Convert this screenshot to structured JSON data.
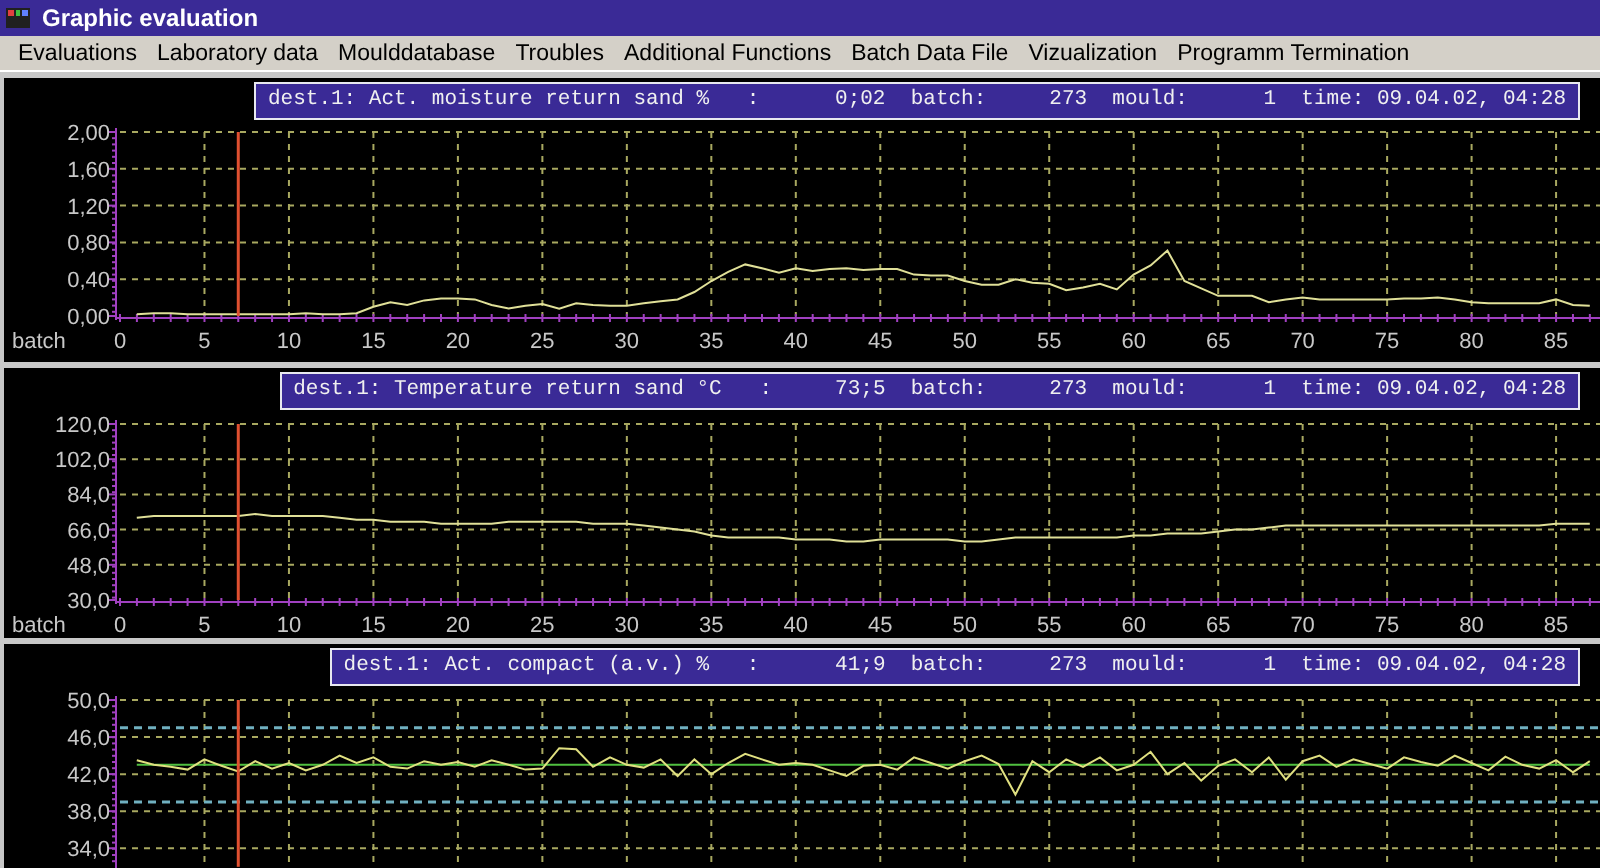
{
  "window": {
    "title": "Graphic evaluation"
  },
  "menu": [
    "Evaluations",
    "Laboratory data",
    "Moulddatabase",
    "Troubles",
    "Additional Functions",
    "Batch Data File",
    "Vizualization",
    "Programm Termination"
  ],
  "panels": [
    {
      "header": "dest.1: Act. moisture return sand %   :      0;02  batch:     273  mould:      1  time: 09.04.02, 04:28",
      "chart_data": {
        "type": "line",
        "xlabel": "batch",
        "xlim": [
          0,
          87.6
        ],
        "ylim": [
          0,
          2
        ],
        "grid": true,
        "x": [
          1,
          2,
          3,
          4,
          5,
          6,
          7,
          8,
          9,
          10,
          11,
          12,
          13,
          14,
          15,
          16,
          17,
          18,
          19,
          20,
          21,
          22,
          23,
          24,
          25,
          26,
          27,
          28,
          29,
          30,
          31,
          32,
          33,
          34,
          35,
          36,
          37,
          38,
          39,
          40,
          41,
          42,
          43,
          44,
          45,
          46,
          47,
          48,
          49,
          50,
          51,
          52,
          53,
          54,
          55,
          56,
          57,
          58,
          59,
          60,
          61,
          62,
          63,
          64,
          65,
          66,
          67,
          68,
          69,
          70,
          71,
          72,
          73,
          74,
          75,
          76,
          77,
          78,
          79,
          80,
          81,
          82,
          83,
          84,
          85,
          86,
          87
        ],
        "series": [
          {
            "color": "#e0e098",
            "values": [
              0.02,
              0.03,
              0.03,
              0.02,
              0.02,
              0.02,
              0.02,
              0.02,
              0.02,
              0.02,
              0.03,
              0.02,
              0.02,
              0.03,
              0.1,
              0.15,
              0.12,
              0.17,
              0.19,
              0.19,
              0.18,
              0.12,
              0.08,
              0.11,
              0.13,
              0.08,
              0.14,
              0.12,
              0.11,
              0.11,
              0.14,
              0.16,
              0.18,
              0.26,
              0.38,
              0.48,
              0.56,
              0.52,
              0.47,
              0.52,
              0.49,
              0.51,
              0.52,
              0.5,
              0.51,
              0.51,
              0.45,
              0.44,
              0.44,
              0.38,
              0.34,
              0.34,
              0.4,
              0.36,
              0.35,
              0.28,
              0.31,
              0.35,
              0.29,
              0.45,
              0.55,
              0.71,
              0.38,
              0.3,
              0.22,
              0.22,
              0.22,
              0.15,
              0.18,
              0.2,
              0.18,
              0.18,
              0.18,
              0.18,
              0.18,
              0.19,
              0.19,
              0.2,
              0.18,
              0.15,
              0.14,
              0.14,
              0.14,
              0.14,
              0.18,
              0.12,
              0.11
            ]
          }
        ],
        "xticks": [
          0,
          5,
          10,
          15,
          20,
          25,
          30,
          35,
          40,
          45,
          50,
          55,
          60,
          65,
          70,
          75,
          80,
          85
        ],
        "yticks": [
          {
            "value": 0,
            "label": "0,00"
          },
          {
            "value": 0.4,
            "label": "0,40"
          },
          {
            "value": 0.8,
            "label": "0,80"
          },
          {
            "value": 1.2,
            "label": "1,20"
          },
          {
            "value": 1.6,
            "label": "1,60"
          },
          {
            "value": 2,
            "label": "2,00"
          }
        ],
        "ref_lines": [
          {
            "axis": "x",
            "value": 7,
            "color": "#e05030"
          }
        ]
      }
    },
    {
      "header": "dest.1: Temperature return sand °C   :     73;5  batch:     273  mould:      1  time: 09.04.02, 04:28",
      "chart_data": {
        "type": "line",
        "xlabel": "batch",
        "xlim": [
          0,
          87.6
        ],
        "ylim": [
          30,
          120
        ],
        "grid": true,
        "x": [
          1,
          2,
          3,
          4,
          5,
          6,
          7,
          8,
          9,
          10,
          11,
          12,
          13,
          14,
          15,
          16,
          17,
          18,
          19,
          20,
          21,
          22,
          23,
          24,
          25,
          26,
          27,
          28,
          29,
          30,
          31,
          32,
          33,
          34,
          35,
          36,
          37,
          38,
          39,
          40,
          41,
          42,
          43,
          44,
          45,
          46,
          47,
          48,
          49,
          50,
          51,
          52,
          53,
          54,
          55,
          56,
          57,
          58,
          59,
          60,
          61,
          62,
          63,
          64,
          65,
          66,
          67,
          68,
          69,
          70,
          71,
          72,
          73,
          74,
          75,
          76,
          77,
          78,
          79,
          80,
          81,
          82,
          83,
          84,
          85,
          86,
          87
        ],
        "series": [
          {
            "color": "#e0e098",
            "values": [
              72,
              73,
              73,
              73,
              73,
              73,
              73,
              74,
              73,
              73,
              73,
              73,
              72,
              71,
              71,
              70,
              70,
              70,
              69,
              69,
              69,
              69,
              70,
              70,
              70,
              70,
              70,
              69,
              69,
              69,
              68,
              67,
              66,
              65,
              63,
              62,
              62,
              62,
              62,
              61,
              61,
              61,
              60,
              60,
              61,
              61,
              61,
              61,
              61,
              60,
              60,
              61,
              62,
              62,
              62,
              62,
              62,
              62,
              62,
              63,
              63,
              64,
              64,
              64,
              65,
              66,
              66,
              67,
              68,
              68,
              68,
              68,
              68,
              68,
              68,
              68,
              68,
              68,
              68,
              68,
              68,
              68,
              68,
              68,
              69,
              69,
              69
            ]
          }
        ],
        "xticks": [
          0,
          5,
          10,
          15,
          20,
          25,
          30,
          35,
          40,
          45,
          50,
          55,
          60,
          65,
          70,
          75,
          80,
          85
        ],
        "yticks": [
          {
            "value": 30,
            "label": "30,0"
          },
          {
            "value": 48,
            "label": "48,0"
          },
          {
            "value": 66,
            "label": "66,0"
          },
          {
            "value": 84,
            "label": "84,0"
          },
          {
            "value": 102,
            "label": "102,0"
          },
          {
            "value": 120,
            "label": "120,0"
          }
        ],
        "ref_lines": [
          {
            "axis": "x",
            "value": 7,
            "color": "#e05030"
          }
        ]
      }
    },
    {
      "header": "dest.1: Act. compact (a.v.) %   :      41;9  batch:     273  mould:      1  time: 09.04.02, 04:28",
      "chart_data": {
        "type": "line",
        "xlim": [
          0,
          87.6
        ],
        "ylim": [
          32,
          50
        ],
        "grid": true,
        "x": [
          1,
          2,
          3,
          4,
          5,
          6,
          7,
          8,
          9,
          10,
          11,
          12,
          13,
          14,
          15,
          16,
          17,
          18,
          19,
          20,
          21,
          22,
          23,
          24,
          25,
          26,
          27,
          28,
          29,
          30,
          31,
          32,
          33,
          34,
          35,
          36,
          37,
          38,
          39,
          40,
          41,
          42,
          43,
          44,
          45,
          46,
          47,
          48,
          49,
          50,
          51,
          52,
          53,
          54,
          55,
          56,
          57,
          58,
          59,
          60,
          61,
          62,
          63,
          64,
          65,
          66,
          67,
          68,
          69,
          70,
          71,
          72,
          73,
          74,
          75,
          76,
          77,
          78,
          79,
          80,
          81,
          82,
          83,
          84,
          85,
          86,
          87
        ],
        "series": [
          {
            "color": "#50c040",
            "values": [
              43,
              43,
              43,
              43,
              43,
              43,
              43,
              43,
              43,
              43,
              43,
              43,
              43,
              43,
              43,
              43,
              43,
              43,
              43,
              43,
              43,
              43,
              43,
              43,
              43,
              43,
              43,
              43,
              43,
              43,
              43,
              43,
              43,
              43,
              43,
              43,
              43,
              43,
              43,
              43,
              43,
              43,
              43,
              43,
              43,
              43,
              43,
              43,
              43,
              43,
              43,
              43,
              43,
              43,
              43,
              43,
              43,
              43,
              43,
              43,
              43,
              43,
              43,
              43,
              43,
              43,
              43,
              43,
              43,
              43,
              43,
              43,
              43,
              43,
              43,
              43,
              43,
              43,
              43,
              43,
              43,
              43,
              43,
              43,
              43,
              43,
              43
            ]
          },
          {
            "color": "#e0e080",
            "values": [
              43.5,
              43,
              42.8,
              42.5,
              43.6,
              42.9,
              42.3,
              43.4,
              42.6,
              43.2,
              42.4,
              43,
              44,
              43.2,
              43.8,
              42.8,
              42.6,
              43.4,
              43,
              43.3,
              42.8,
              43.5,
              43,
              42.5,
              42.6,
              44.8,
              44.7,
              42.8,
              43.8,
              43,
              42.7,
              43.6,
              41.8,
              43.6,
              42,
              43.2,
              44.2,
              43.6,
              43,
              43.2,
              43,
              42.4,
              41.8,
              42.9,
              43,
              42.5,
              43.8,
              43.2,
              42.6,
              43.4,
              44,
              43.1,
              39.8,
              43.4,
              42.2,
              43.6,
              42.8,
              43.8,
              42.4,
              43,
              44.4,
              42,
              43.2,
              41.3,
              42.9,
              43.6,
              42.2,
              43.8,
              41.4,
              43.4,
              44,
              42.8,
              43.6,
              43.1,
              42.6,
              43.8,
              43.3,
              42.9,
              44,
              43.2,
              42.4,
              43.9,
              43,
              42.6,
              43.5,
              42.2,
              43.4
            ]
          }
        ],
        "yticks": [
          {
            "value": 34,
            "label": "34,0"
          },
          {
            "value": 38,
            "label": "38,0"
          },
          {
            "value": 42,
            "label": "42,0"
          },
          {
            "value": 46,
            "label": "46,0"
          },
          {
            "value": 50,
            "label": "50,0"
          }
        ],
        "ref_lines": [
          {
            "axis": "y",
            "value": 47,
            "color": "#70b0c0"
          },
          {
            "axis": "y",
            "value": 39,
            "color": "#70b0c0"
          },
          {
            "axis": "x",
            "value": 7,
            "color": "#e05030"
          }
        ]
      }
    }
  ]
}
